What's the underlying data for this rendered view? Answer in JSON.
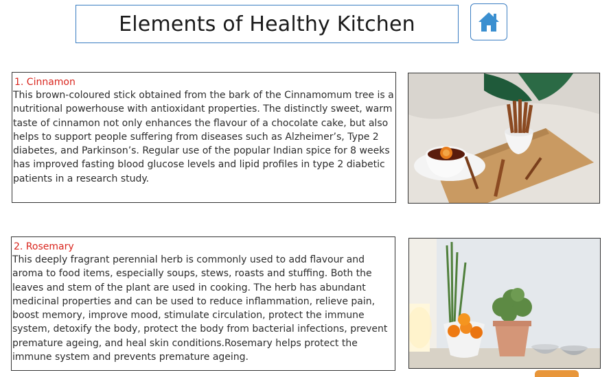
{
  "header": {
    "title": "Elements of Healthy Kitchen",
    "home_icon": "home-icon"
  },
  "sections": [
    {
      "heading": "1. Cinnamon",
      "text": "This brown-coloured stick obtained from the bark of the Cinnamomum tree is a nutritional powerhouse with antioxidant properties. The distinctly sweet, warm taste of cinnamon not only enhances the flavour of a chocolate cake, but also helps to support people suffering from diseases such as Alzheimer’s, Type 2 diabetes, and Parkinson’s. Regular use of the popular Indian spice for 8 weeks has improved fasting blood glucose levels and lipid profiles in type 2 diabetic patients in a research study."
    },
    {
      "heading": "2. Rosemary",
      "text": "This deeply fragrant perennial herb is commonly used to add flavour and aroma to food items, especially soups, stews, roasts and stuffing. Both the leaves and stem of the plant are used in cooking. The herb has abundant medicinal properties and can be used to reduce inflammation, relieve pain, boost memory, improve mood, stimulate circulation, protect the immune system, detoxify the body, protect the body from bacterial infections, prevent premature ageing, and heal skin conditions.Rosemary helps protect the immune system and prevents premature ageing."
    }
  ],
  "colors": {
    "accent_blue": "#3a7dc2",
    "heading_red": "#d9251d",
    "tab_orange": "#e8963a"
  }
}
